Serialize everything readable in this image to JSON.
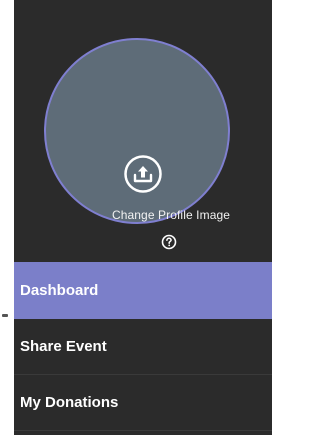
{
  "profile": {
    "change_image_label": "Change Profile Image",
    "upload_icon": "upload-icon",
    "help_icon": "help-icon"
  },
  "nav": {
    "items": [
      {
        "label": "Dashboard",
        "active": true
      },
      {
        "label": "Share Event",
        "active": false
      },
      {
        "label": "My Donations",
        "active": false
      }
    ]
  },
  "colors": {
    "drawer_background": "#2b2b2b",
    "avatar_fill": "#5e6c78",
    "avatar_ring": "#7f7fd0",
    "active_item": "#7b7fc9"
  }
}
